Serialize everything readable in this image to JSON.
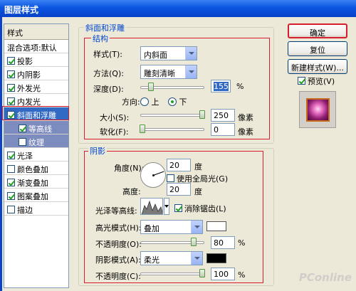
{
  "window": {
    "title": "图层样式"
  },
  "stylelist": {
    "header": "样式",
    "items": [
      {
        "label": "混合选项:默认",
        "checkbox": false,
        "checked": false
      },
      {
        "label": "投影",
        "checkbox": true,
        "checked": true
      },
      {
        "label": "内阴影",
        "checkbox": true,
        "checked": true
      },
      {
        "label": "外发光",
        "checkbox": true,
        "checked": true
      },
      {
        "label": "内发光",
        "checkbox": true,
        "checked": true
      },
      {
        "label": "斜面和浮雕",
        "checkbox": true,
        "checked": true,
        "selected": true
      },
      {
        "label": "等高线",
        "checkbox": true,
        "checked": true,
        "sub": true
      },
      {
        "label": "纹理",
        "checkbox": true,
        "checked": false,
        "sub": true
      },
      {
        "label": "光泽",
        "checkbox": true,
        "checked": true
      },
      {
        "label": "颜色叠加",
        "checkbox": true,
        "checked": false
      },
      {
        "label": "渐变叠加",
        "checkbox": true,
        "checked": true
      },
      {
        "label": "图案叠加",
        "checkbox": true,
        "checked": true
      },
      {
        "label": "描边",
        "checkbox": true,
        "checked": false
      }
    ]
  },
  "bevel": {
    "group_title": "斜面和浮雕",
    "sub_title": "结构",
    "style_label": "样式(T):",
    "style_value": "内斜面",
    "method_label": "方法(Q):",
    "method_value": "雕刻清晰",
    "depth_label": "深度(D):",
    "depth_value": "155",
    "depth_unit": "%",
    "depth_level": 0.155,
    "direction_label": "方向:",
    "dir_up": "上",
    "dir_down": "下",
    "size_label": "大小(S):",
    "size_value": "250",
    "size_unit": "像素",
    "soften_label": "软化(F):",
    "soften_value": "0",
    "soften_unit": "像素"
  },
  "shading": {
    "title": "阴影",
    "angle_label": "角度(N):",
    "angle_value": "20",
    "angle_unit": "度",
    "global_light_label": "使用全局光(G)",
    "altitude_label": "高度:",
    "altitude_value": "20",
    "altitude_unit": "度",
    "gloss_contour_label": "光泽等高线:",
    "antialias_label": "消除锯齿(L)",
    "highlight_mode_label": "高光模式(H):",
    "highlight_mode_value": "叠加",
    "highlight_color": "#ffffff",
    "opacity1_label": "不透明度(O):",
    "opacity1_value": "80",
    "opacity1_unit": "%",
    "shadow_mode_label": "阴影模式(A):",
    "shadow_mode_value": "柔光",
    "shadow_color": "#000000",
    "opacity2_label": "不透明度(C):",
    "opacity2_value": "100",
    "opacity2_unit": "%"
  },
  "buttons": {
    "ok": "确定",
    "reset": "复位",
    "new_style": "新建样式(W)...",
    "preview": "预览(V)"
  },
  "watermark": "PConline"
}
